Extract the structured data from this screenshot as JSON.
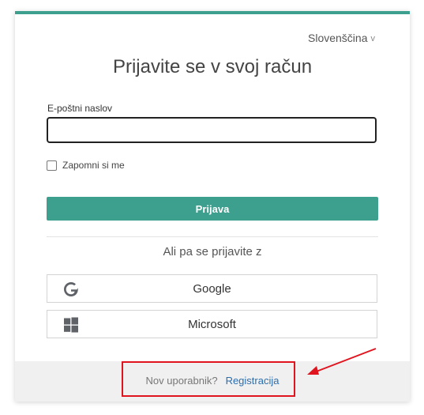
{
  "language": {
    "label": "Slovenščina",
    "chevron": "v"
  },
  "title": "Prijavite se v svoj račun",
  "email": {
    "label": "E-poštni naslov",
    "value": "",
    "placeholder": ""
  },
  "remember": {
    "label": "Zapomni si me",
    "checked": false
  },
  "login_button": "Prijava",
  "alt_text": "Ali pa se prijavite z",
  "providers": [
    {
      "label": "Google",
      "icon": "google-icon"
    },
    {
      "label": "Microsoft",
      "icon": "microsoft-icon"
    }
  ],
  "footer": {
    "question": "Nov uporabnik?",
    "link": "Registracija"
  },
  "colors": {
    "accent": "#3d9f8e",
    "annotation": "#e0141e",
    "link": "#2a6fb0"
  }
}
